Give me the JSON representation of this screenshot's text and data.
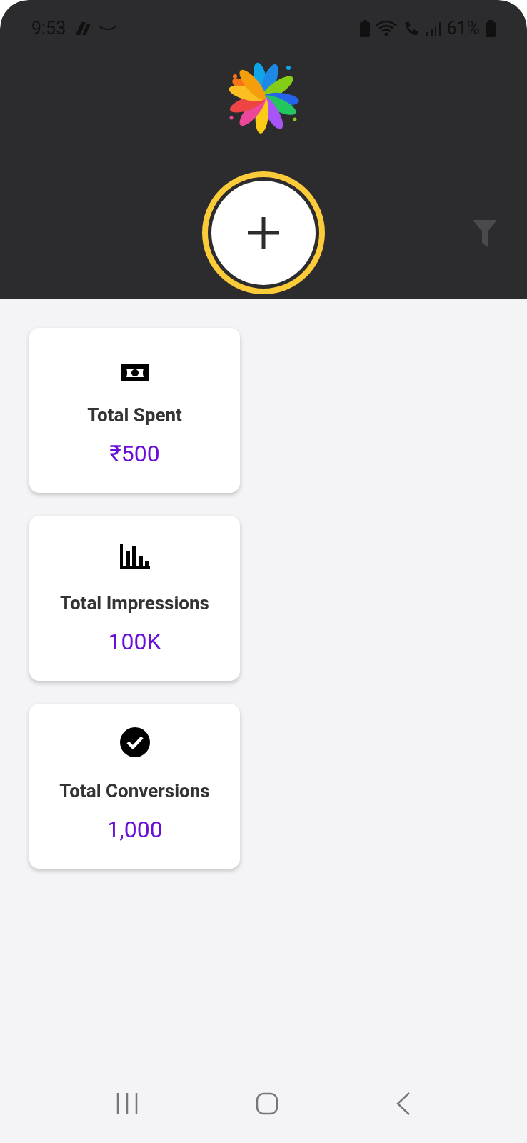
{
  "status_bar": {
    "time": "9:53",
    "battery": "61%"
  },
  "stats": [
    {
      "kind": "money",
      "label": "Total Spent",
      "value": "₹500"
    },
    {
      "kind": "chart",
      "label": "Total Impressions",
      "value": "100K"
    },
    {
      "kind": "check",
      "label": "Total Conversions",
      "value": "1,000"
    }
  ]
}
